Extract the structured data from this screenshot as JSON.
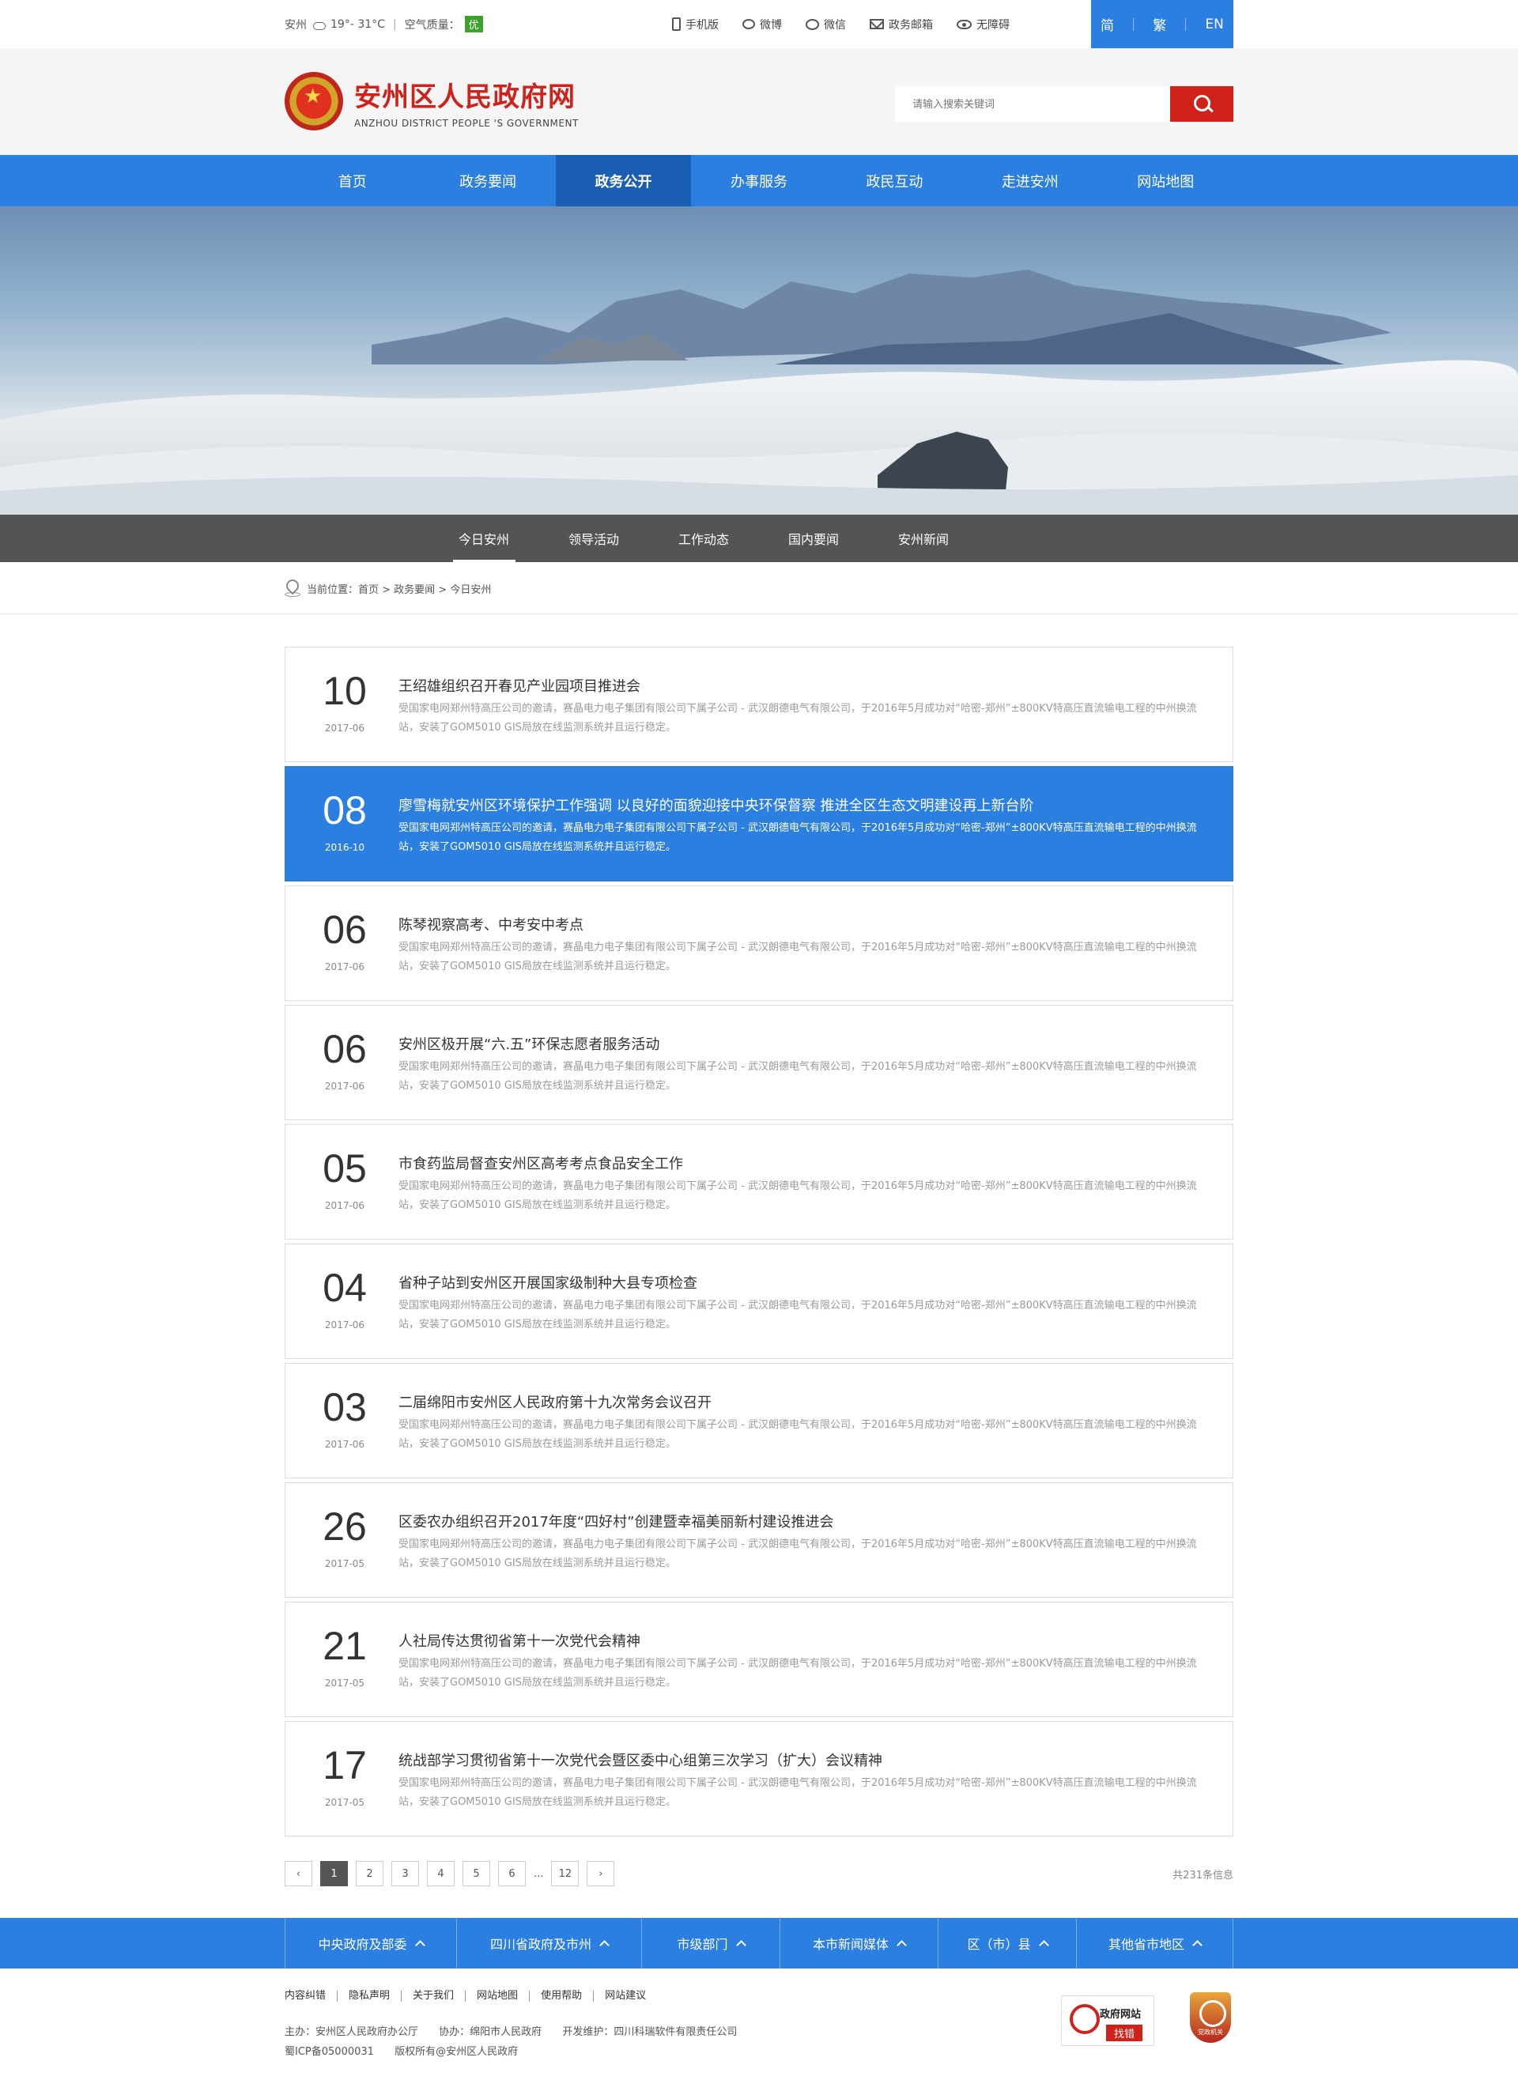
{
  "topbar": {
    "city": "安州",
    "temperature": "19°- 31°C",
    "aq_label": "空气质量：",
    "aq_value": "优",
    "links": [
      "手机版",
      "微博",
      "微信",
      "政务邮箱",
      "无障碍"
    ],
    "langs": [
      "简",
      "繁",
      "EN"
    ]
  },
  "header": {
    "title": "安州区人民政府网",
    "subtitle": "ANZHOU DISTRICT PEOPLE 'S GOVERNMENT",
    "search_placeholder": "请输入搜索关键词"
  },
  "nav": {
    "items": [
      "首页",
      "政务要闻",
      "政务公开",
      "办事服务",
      "政民互动",
      "走进安州",
      "网站地图"
    ],
    "active_index": 2
  },
  "subnav": {
    "items": [
      "今日安州",
      "领导活动",
      "工作动态",
      "国内要闻",
      "安州新闻"
    ],
    "active_index": 0
  },
  "breadcrumb": "当前位置：首页 > 政务要闻 > 今日安州",
  "news": [
    {
      "day": "10",
      "ym": "2017-06",
      "title": "王绍雄组织召开春见产业园项目推进会",
      "desc": "受国家电网郑州特高压公司的邀请，赛晶电力电子集团有限公司下属子公司 - 武汉朗德电气有限公司，于2016年5月成功对“哈密-郑州”±800KV特高压直流输电工程的中州换流站，安装了GOM5010 GIS局放在线监测系统并且运行稳定。"
    },
    {
      "day": "08",
      "ym": "2016-10",
      "title": "廖雪梅就安州区环境保护工作强调 以良好的面貌迎接中央环保督察 推进全区生态文明建设再上新台阶",
      "desc": "受国家电网郑州特高压公司的邀请，赛晶电力电子集团有限公司下属子公司 - 武汉朗德电气有限公司，于2016年5月成功对“哈密-郑州”±800KV特高压直流输电工程的中州换流站，安装了GOM5010 GIS局放在线监测系统并且运行稳定。",
      "active": true
    },
    {
      "day": "06",
      "ym": "2017-06",
      "title": "陈琴视察高考、中考安中考点",
      "desc": "受国家电网郑州特高压公司的邀请，赛晶电力电子集团有限公司下属子公司 - 武汉朗德电气有限公司，于2016年5月成功对“哈密-郑州”±800KV特高压直流输电工程的中州换流站，安装了GOM5010 GIS局放在线监测系统并且运行稳定。"
    },
    {
      "day": "06",
      "ym": "2017-06",
      "title": "安州区极开展“六.五”环保志愿者服务活动",
      "desc": "受国家电网郑州特高压公司的邀请，赛晶电力电子集团有限公司下属子公司 - 武汉朗德电气有限公司，于2016年5月成功对“哈密-郑州”±800KV特高压直流输电工程的中州换流站，安装了GOM5010 GIS局放在线监测系统并且运行稳定。"
    },
    {
      "day": "05",
      "ym": "2017-06",
      "title": "市食药监局督查安州区高考考点食品安全工作",
      "desc": "受国家电网郑州特高压公司的邀请，赛晶电力电子集团有限公司下属子公司 - 武汉朗德电气有限公司，于2016年5月成功对“哈密-郑州”±800KV特高压直流输电工程的中州换流站，安装了GOM5010 GIS局放在线监测系统并且运行稳定。"
    },
    {
      "day": "04",
      "ym": "2017-06",
      "title": "省种子站到安州区开展国家级制种大县专项检查",
      "desc": "受国家电网郑州特高压公司的邀请，赛晶电力电子集团有限公司下属子公司 - 武汉朗德电气有限公司，于2016年5月成功对“哈密-郑州”±800KV特高压直流输电工程的中州换流站，安装了GOM5010 GIS局放在线监测系统并且运行稳定。"
    },
    {
      "day": "03",
      "ym": "2017-06",
      "title": "二届绵阳市安州区人民政府第十九次常务会议召开",
      "desc": "受国家电网郑州特高压公司的邀请，赛晶电力电子集团有限公司下属子公司 - 武汉朗德电气有限公司，于2016年5月成功对“哈密-郑州”±800KV特高压直流输电工程的中州换流站，安装了GOM5010 GIS局放在线监测系统并且运行稳定。"
    },
    {
      "day": "26",
      "ym": "2017-05",
      "title": "区委农办组织召开2017年度“四好村”创建暨幸福美丽新村建设推进会",
      "desc": "受国家电网郑州特高压公司的邀请，赛晶电力电子集团有限公司下属子公司 - 武汉朗德电气有限公司，于2016年5月成功对“哈密-郑州”±800KV特高压直流输电工程的中州换流站，安装了GOM5010 GIS局放在线监测系统并且运行稳定。"
    },
    {
      "day": "21",
      "ym": "2017-05",
      "title": "人社局传达贯彻省第十一次党代会精神",
      "desc": "受国家电网郑州特高压公司的邀请，赛晶电力电子集团有限公司下属子公司 - 武汉朗德电气有限公司，于2016年5月成功对“哈密-郑州”±800KV特高压直流输电工程的中州换流站，安装了GOM5010 GIS局放在线监测系统并且运行稳定。"
    },
    {
      "day": "17",
      "ym": "2017-05",
      "title": "统战部学习贯彻省第十一次党代会暨区委中心组第三次学习（扩大）会议精神",
      "desc": "受国家电网郑州特高压公司的邀请，赛晶电力电子集团有限公司下属子公司 - 武汉朗德电气有限公司，于2016年5月成功对“哈密-郑州”±800KV特高压直流输电工程的中州换流站，安装了GOM5010 GIS局放在线监测系统并且运行稳定。"
    }
  ],
  "pager": {
    "prev": "‹",
    "pages": [
      "1",
      "2",
      "3",
      "4",
      "5",
      "6"
    ],
    "dots": "...",
    "last": "12",
    "next": "›",
    "total": "共231条信息"
  },
  "linkbar": {
    "items": [
      "中央政府及部委",
      "四川省政府及市州",
      "市级部门",
      "本市新闻媒体",
      "区（市）县",
      "其他省市地区"
    ]
  },
  "footer": {
    "links": [
      "内容纠错",
      "隐私声明",
      "关于我们",
      "网站地图",
      "使用帮助",
      "网站建议"
    ],
    "host": "主办：安州区人民政府办公厅",
    "co": "协办：绵阳市人民政府",
    "dev": "开发维护：四川科瑞软件有限责任公司",
    "icp": "蜀ICP备05000031",
    "copyright": "版权所有@安州区人民政府",
    "badge1_title": "政府网站",
    "badge1_tag": "找错",
    "badge2_text": "党政机关"
  },
  "colors": {
    "brand_blue": "#2b7fe0",
    "brand_red": "#d0221a",
    "aq_green": "#3ea12b"
  }
}
